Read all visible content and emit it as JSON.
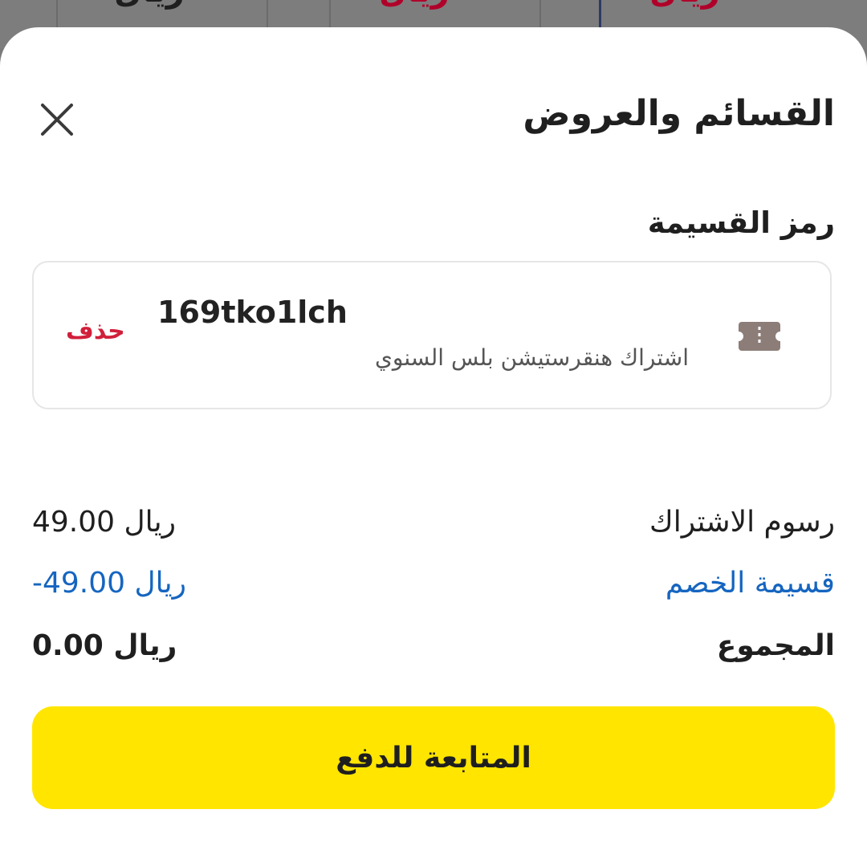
{
  "background": {
    "tabs": [
      {
        "text": "ريال",
        "color": "#1f1f1f"
      },
      {
        "text": "ريال",
        "color": "#b0002a"
      },
      {
        "text": "ريال",
        "color": "#b0002a"
      }
    ]
  },
  "sheet": {
    "title": "القسائم والعروض",
    "close_icon": "close-icon",
    "voucher_section_label": "رمز القسيمة",
    "voucher": {
      "icon": "ticket-icon",
      "code": "169tko1lch",
      "description": "اشتراك هنقرستيشن بلس السنوي",
      "delete_label": "حذف"
    },
    "summary": {
      "fees_label": "رسوم الاشتراك",
      "fees_value": "49.00 ريال",
      "discount_label": "قسيمة الخصم",
      "discount_value": "-49.00 ريال",
      "total_label": "المجموع",
      "total_value": "0.00 ريال"
    },
    "pay_button_label": "المتابعة للدفع"
  },
  "colors": {
    "accent_yellow": "#ffe500",
    "discount_blue": "#1565c0",
    "delete_red": "#d11f3a",
    "overlay": "#7b7b7b"
  }
}
